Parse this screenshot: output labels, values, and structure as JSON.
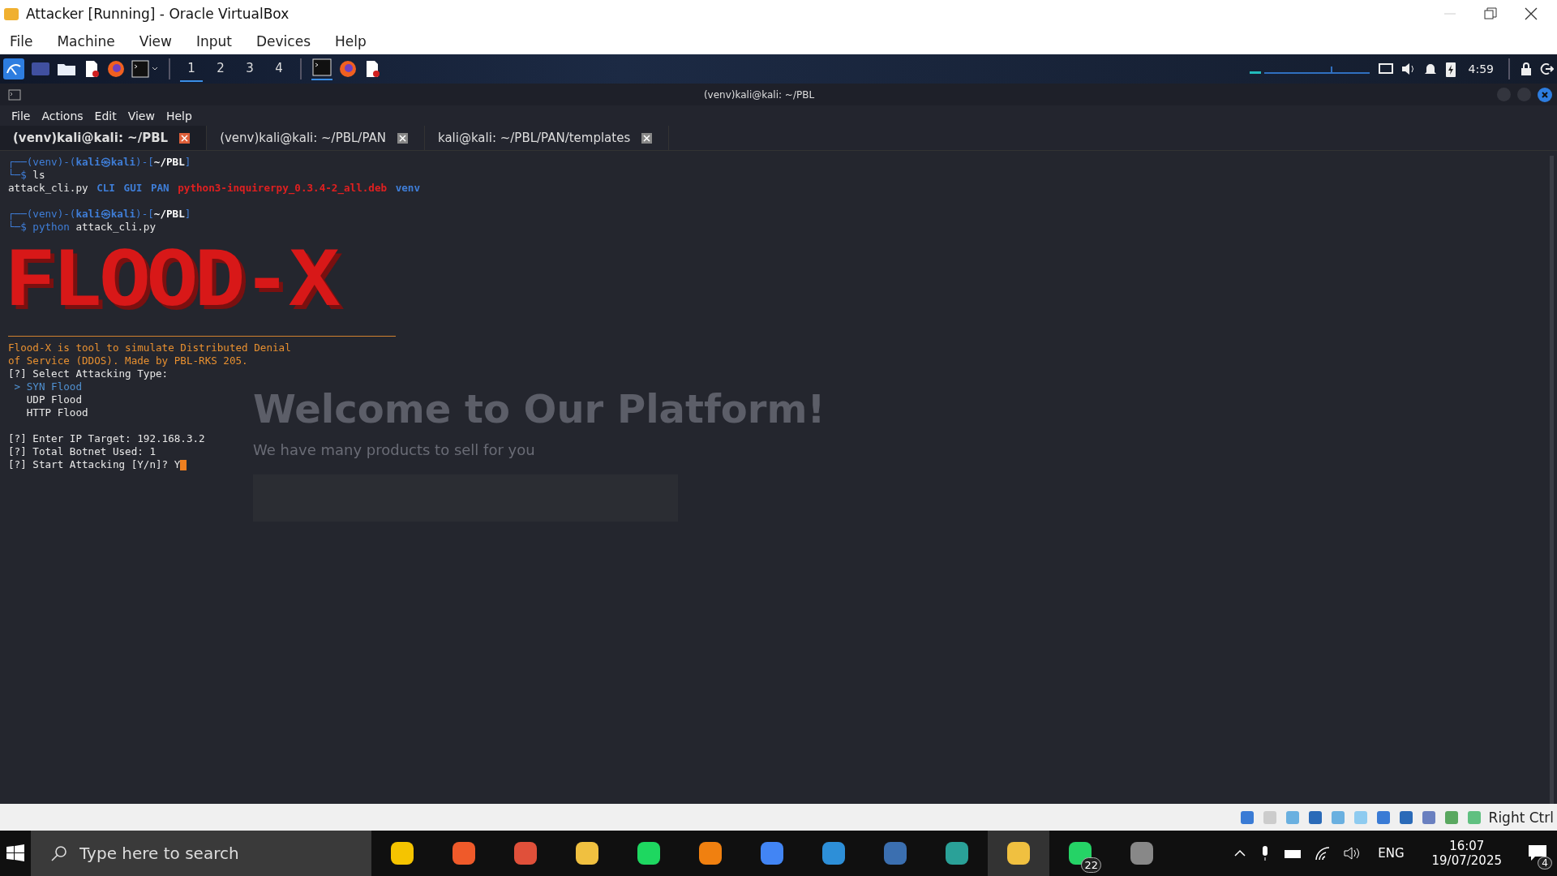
{
  "window": {
    "title": "Attacker [Running] - Oracle VirtualBox"
  },
  "menu": [
    "File",
    "Machine",
    "View",
    "Input",
    "Devices",
    "Help"
  ],
  "kali_panel": {
    "workspaces": [
      {
        "label": "1",
        "selected": true
      },
      {
        "label": "2",
        "selected": false
      },
      {
        "label": "3",
        "selected": false
      },
      {
        "label": "4",
        "selected": false
      }
    ],
    "clock": "4:59"
  },
  "terminal": {
    "title": "(venv)kali@kali: ~/PBL",
    "menu": [
      "File",
      "Actions",
      "Edit",
      "View",
      "Help"
    ],
    "tabs": [
      {
        "label": "(venv)kali@kali: ~/PBL",
        "selected": true
      },
      {
        "label": "(venv)kali@kali: ~/PBL/PAN",
        "selected": false
      },
      {
        "label": "kali@kali: ~/PBL/PAN/templates",
        "selected": false
      }
    ],
    "lines": [
      [
        {
          "kind": "frame",
          "text": "┌──(venv)-("
        },
        {
          "kind": "user",
          "text": "kali㉿kali"
        },
        {
          "kind": "frame",
          "text": ")-["
        },
        {
          "kind": "path",
          "text": "~/PBL"
        },
        {
          "kind": "frame",
          "text": "]"
        }
      ],
      [
        {
          "kind": "frame",
          "text": "└─$"
        },
        {
          "kind": "plain",
          "text": " ls"
        }
      ],
      [
        {
          "kind": "plain",
          "text": "attack_cli.py"
        },
        {
          "kind": "dir",
          "text": "CLI"
        },
        {
          "kind": "dir",
          "text": "GUI"
        },
        {
          "kind": "dir",
          "text": "PAN"
        },
        {
          "kind": "deb",
          "text": "python3-inquirerpy_0.3.4-2_all.deb"
        },
        {
          "kind": "dir",
          "text": "venv"
        }
      ],
      [
        {
          "kind": "gap"
        },
        {
          "kind": "frame",
          "text": "┌──(venv)-("
        },
        {
          "kind": "user",
          "text": "kali㉿kali"
        },
        {
          "kind": "frame",
          "text": ")-["
        },
        {
          "kind": "path",
          "text": "~/PBL"
        },
        {
          "kind": "frame",
          "text": "]"
        }
      ],
      [
        {
          "kind": "frame",
          "text": "└─$"
        },
        {
          "kind": "cmd",
          "text": " python"
        },
        {
          "kind": "plain",
          "text": " attack_cli.py"
        }
      ]
    ],
    "banner": "FLOOD-X",
    "output": [
      [
        {
          "kind": "accent",
          "text": "Flood-X is tool to simulate Distributed Denial"
        }
      ],
      [
        {
          "kind": "accent",
          "text": "of Service (DDOS). Made by PBL-RKS 205."
        }
      ],
      [
        {
          "kind": "plain",
          "text": "[?] Select Attacking Type:"
        }
      ],
      [
        {
          "kind": "option",
          "text": " > SYN Flood"
        }
      ],
      [
        {
          "kind": "plain",
          "text": "   UDP Flood"
        }
      ],
      [
        {
          "kind": "plain",
          "text": "   HTTP Flood"
        }
      ],
      [
        {
          "kind": "gap"
        },
        {
          "kind": "plain",
          "text": "[?] Enter IP Target: 192.168.3.2"
        }
      ],
      [
        {
          "kind": "plain",
          "text": "[?] Total Botnet Used: 1"
        }
      ],
      [
        {
          "kind": "plain",
          "text": "[?] Start Attacking [Y/n]? Y"
        }
      ]
    ],
    "background_page": {
      "heading": "Welcome to Our Platform!",
      "subheading": "We have many products to sell for you"
    }
  },
  "status_bar": {
    "host_key": "Right Ctrl"
  },
  "taskbar": {
    "search": {
      "placeholder": "Type here to search"
    },
    "whatsapp_badge": "22",
    "language": "ENG",
    "time": "16:07",
    "date": "19/07/2025",
    "notifications": "4"
  }
}
